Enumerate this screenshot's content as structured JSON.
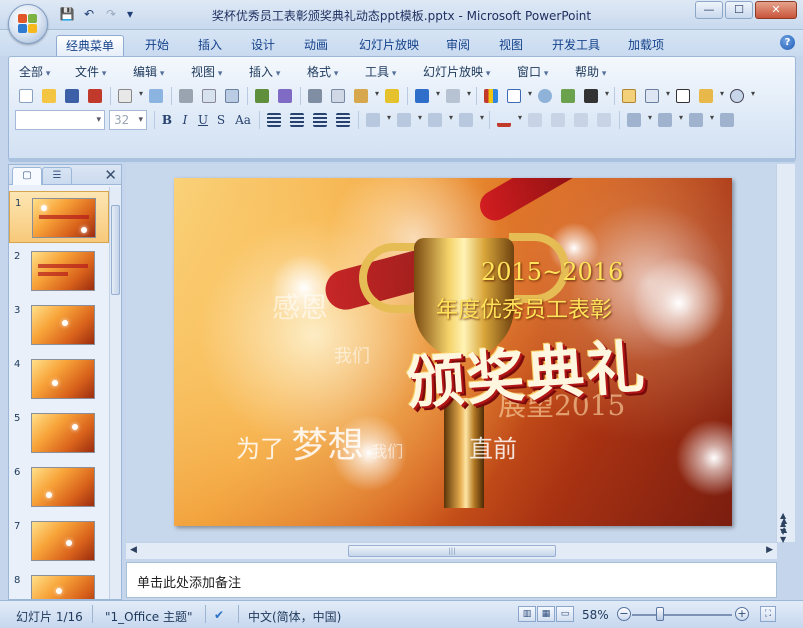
{
  "window": {
    "title": "奖杯优秀员工表彰颁奖典礼动态ppt模板.pptx - Microsoft PowerPoint",
    "controls": [
      "—",
      "☐",
      "✕"
    ]
  },
  "qat": {
    "save": "💾",
    "undo": "↶",
    "redo": "↷",
    "more": "▾"
  },
  "tabs": [
    {
      "label": "经典菜单",
      "active": true
    },
    {
      "label": "开始"
    },
    {
      "label": "插入"
    },
    {
      "label": "设计"
    },
    {
      "label": "动画"
    },
    {
      "label": "幻灯片放映"
    },
    {
      "label": "审阅"
    },
    {
      "label": "视图"
    },
    {
      "label": "开发工具"
    },
    {
      "label": "加载项"
    }
  ],
  "help_label": "?",
  "menus": [
    "全部",
    "文件",
    "编辑",
    "视图",
    "插入",
    "格式",
    "工具",
    "幻灯片放映",
    "窗口",
    "帮助"
  ],
  "format": {
    "font_name": "",
    "font_size": "32",
    "bold": "B",
    "italic": "I",
    "underline": "U",
    "strike": "S",
    "case": "Aa"
  },
  "panel": {
    "tab_slides": "▢",
    "tab_outline": "☰",
    "close": "✕"
  },
  "slides": [
    {
      "num": "1",
      "selected": true
    },
    {
      "num": "2"
    },
    {
      "num": "3"
    },
    {
      "num": "4"
    },
    {
      "num": "5"
    },
    {
      "num": "6"
    },
    {
      "num": "7"
    },
    {
      "num": "8"
    }
  ],
  "slide": {
    "year": "2015~2016",
    "subtitle": "年度优秀员工表彰",
    "main": "颁奖典礼",
    "ghost1": "感恩",
    "ghost2": "我们",
    "ghost3": "展望2015",
    "dream_prefix": "为了",
    "dream_big": "梦想",
    "dream_mid": "我们",
    "dream_suffix": "直前"
  },
  "notes_placeholder": "单击此处添加备注",
  "status": {
    "slide_info": "幻灯片 1/16",
    "theme": "\"1_Office 主题\"",
    "language": "中文(简体，中国)",
    "zoom": "58%",
    "zoom_fraction": 0.58
  },
  "colors": {
    "ribbon_bg": "#dbe7f6",
    "accent": "#15428b",
    "selection": "#f8c97a",
    "slide_title": "#ffe35a"
  }
}
